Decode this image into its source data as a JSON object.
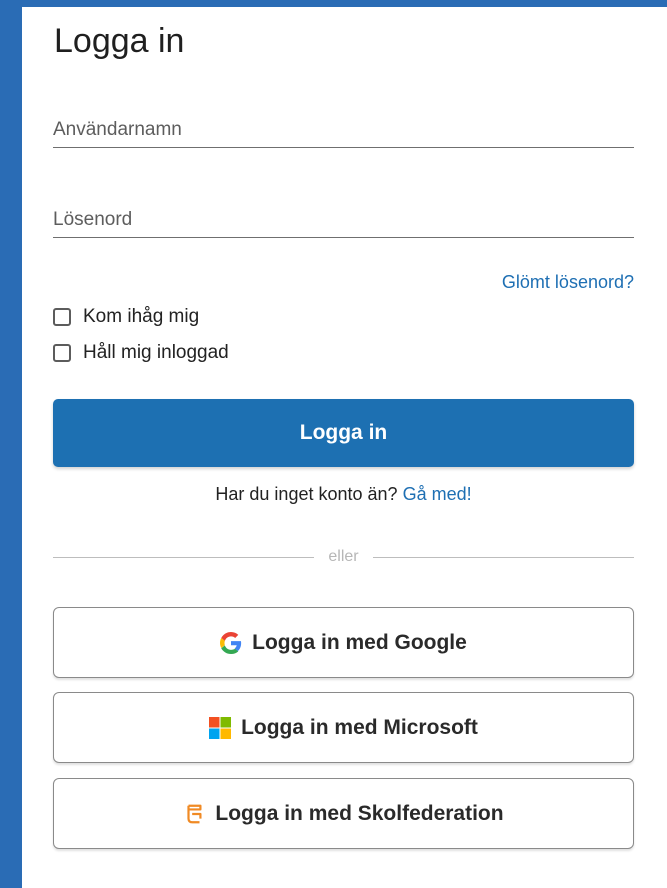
{
  "login": {
    "title": "Logga in",
    "username_placeholder": "Användarnamn",
    "password_placeholder": "Lösenord",
    "forgot_label": "Glömt lösenord?",
    "remember_label": "Kom ihåg mig",
    "stay_label": "Håll mig inloggad",
    "submit_label": "Logga in",
    "signup_text": "Har du inget konto än?",
    "signup_link": "Gå med!",
    "divider_text": "eller"
  },
  "sso": {
    "google_label": "Logga in med Google",
    "microsoft_label": "Logga in med Microsoft",
    "skolfederation_label": "Logga in med Skolfederation"
  },
  "colors": {
    "frame_blue": "#2a6cb5",
    "primary": "#1d70b2",
    "link": "#1e6fb3",
    "skolfederation_orange": "#f08a24"
  },
  "icons": {
    "google": "google-g-icon",
    "microsoft": "microsoft-logo-icon",
    "skolfederation": "skolfederation-logo-icon"
  }
}
